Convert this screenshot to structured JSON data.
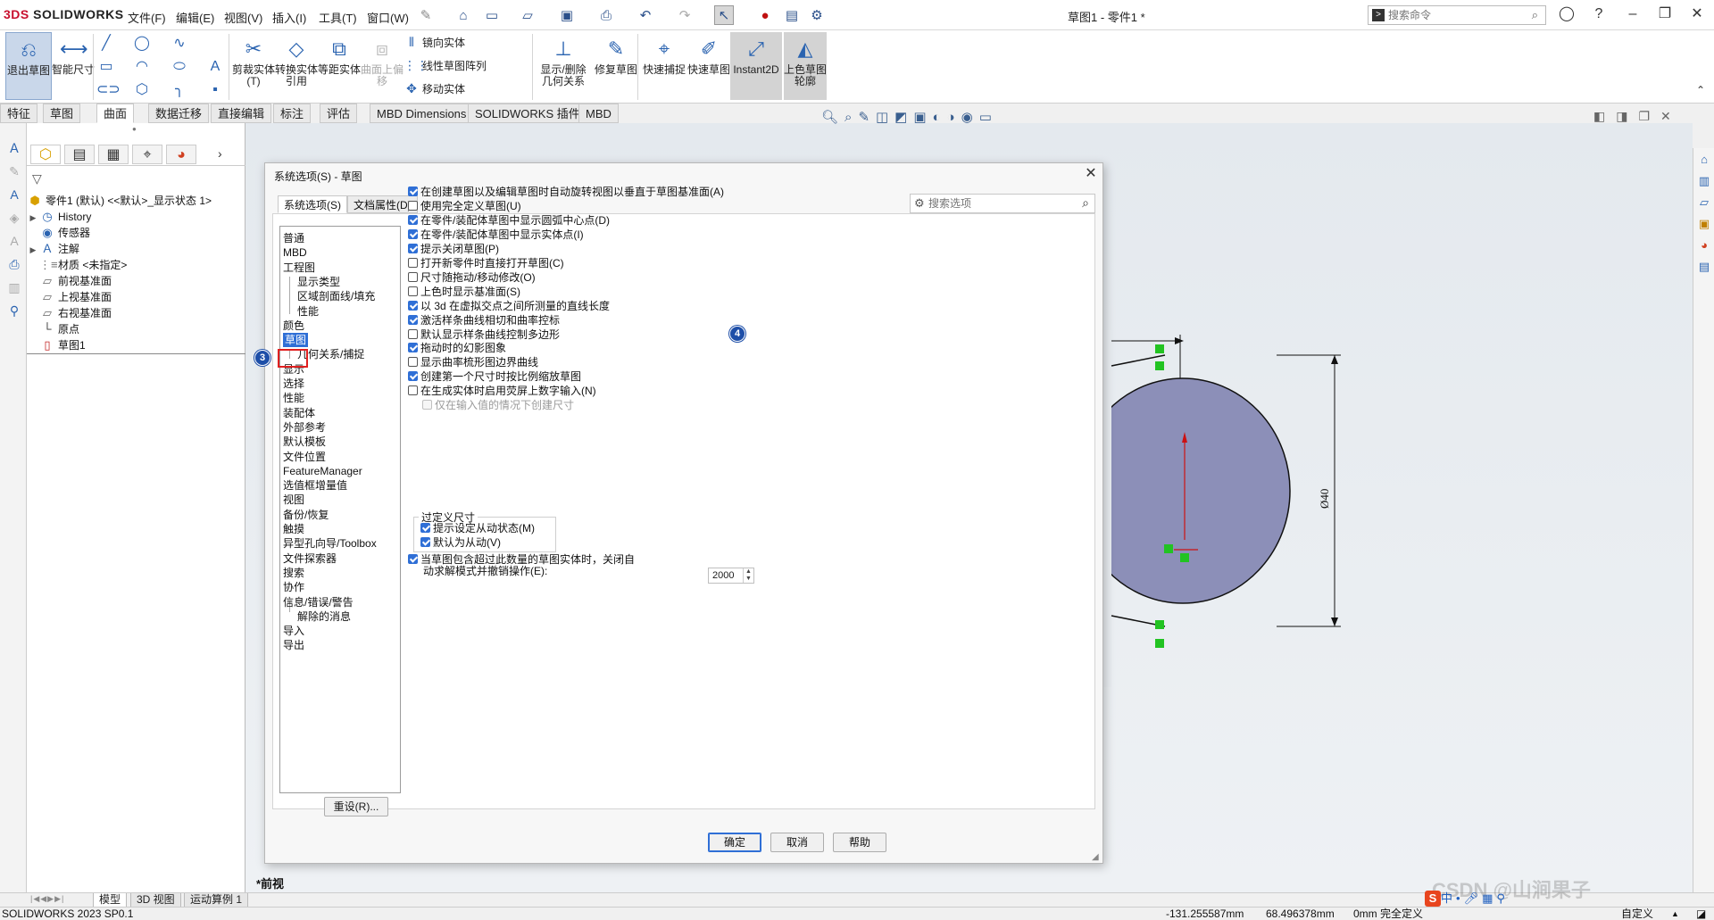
{
  "app": {
    "logo_prefix": "3DS",
    "logo_text": "SOLIDWORKS",
    "title": "草图1 - 零件1 *",
    "menus": [
      "文件(F)",
      "编辑(E)",
      "视图(V)",
      "插入(I)",
      "工具(T)",
      "窗口(W)"
    ],
    "command_search_placeholder": "搜索命令"
  },
  "ribbon": {
    "big_buttons": [
      {
        "label": "退出草图",
        "icon": "exit-sketch-icon"
      },
      {
        "label": "智能尺寸",
        "icon": "smart-dimension-icon"
      },
      {
        "label": "剪裁实体(T)",
        "icon": "trim-icon"
      },
      {
        "label": "转换实体引用",
        "icon": "convert-icon"
      },
      {
        "label": "等距实体",
        "icon": "offset-icon"
      },
      {
        "label": "曲面上偏移",
        "icon": "surface-offset-icon"
      },
      {
        "label": "显示/删除几何关系",
        "icon": "relations-icon"
      },
      {
        "label": "修复草图",
        "icon": "repair-icon"
      },
      {
        "label": "快速捕捉",
        "icon": "quick-snap-icon"
      },
      {
        "label": "快速草图",
        "icon": "rapid-sketch-icon"
      },
      {
        "label": "Instant2D",
        "icon": "instant2d-icon"
      },
      {
        "label": "上色草图轮廓",
        "icon": "shaded-contours-icon"
      }
    ],
    "small_buttons": [
      {
        "label": "镜向实体",
        "icon": "mirror-icon"
      },
      {
        "label": "线性草图阵列",
        "icon": "linear-pattern-icon"
      },
      {
        "label": "移动实体",
        "icon": "move-icon"
      }
    ]
  },
  "command_tabs": [
    "特征",
    "草图",
    "曲面",
    "数据迁移",
    "直接编辑",
    "标注",
    "评估",
    "MBD Dimensions",
    "SOLIDWORKS 插件",
    "MBD"
  ],
  "command_tabs_active": "草图",
  "feature_tree": {
    "root": "零件1 (默认) <<默认>_显示状态 1>",
    "items": [
      {
        "label": "History",
        "expandable": true,
        "icon": "history-icon"
      },
      {
        "label": "传感器",
        "expandable": false,
        "icon": "sensor-icon"
      },
      {
        "label": "注解",
        "expandable": true,
        "icon": "annotation-icon"
      },
      {
        "label": "材质 <未指定>",
        "expandable": false,
        "icon": "material-icon"
      },
      {
        "label": "前视基准面",
        "expandable": false,
        "icon": "plane-icon"
      },
      {
        "label": "上视基准面",
        "expandable": false,
        "icon": "plane-icon"
      },
      {
        "label": "右视基准面",
        "expandable": false,
        "icon": "plane-icon"
      },
      {
        "label": "原点",
        "expandable": false,
        "icon": "origin-icon"
      },
      {
        "label": "草图1",
        "expandable": false,
        "icon": "sketch-icon"
      }
    ]
  },
  "dialog": {
    "title": "系统选项(S) - 草图",
    "tabs": [
      "系统选项(S)",
      "文档属性(D)"
    ],
    "search_placeholder": "搜索选项",
    "nav": [
      {
        "label": "普通",
        "level": 0
      },
      {
        "label": "MBD",
        "level": 0
      },
      {
        "label": "工程图",
        "level": 0
      },
      {
        "label": "显示类型",
        "level": 1
      },
      {
        "label": "区域剖面线/填充",
        "level": 1
      },
      {
        "label": "性能",
        "level": 1
      },
      {
        "label": "颜色",
        "level": 0
      },
      {
        "label": "草图",
        "level": 0,
        "selected": true
      },
      {
        "label": "几何关系/捕捉",
        "level": 1
      },
      {
        "label": "显示",
        "level": 0
      },
      {
        "label": "选择",
        "level": 0
      },
      {
        "label": "性能",
        "level": 0
      },
      {
        "label": "装配体",
        "level": 0
      },
      {
        "label": "外部参考",
        "level": 0
      },
      {
        "label": "默认模板",
        "level": 0
      },
      {
        "label": "文件位置",
        "level": 0
      },
      {
        "label": "FeatureManager",
        "level": 0
      },
      {
        "label": "选值框增量值",
        "level": 0
      },
      {
        "label": "视图",
        "level": 0
      },
      {
        "label": "备份/恢复",
        "level": 0
      },
      {
        "label": "触摸",
        "level": 0
      },
      {
        "label": "异型孔向导/Toolbox",
        "level": 0
      },
      {
        "label": "文件探索器",
        "level": 0
      },
      {
        "label": "搜索",
        "level": 0
      },
      {
        "label": "协作",
        "level": 0
      },
      {
        "label": "信息/错误/警告",
        "level": 0
      },
      {
        "label": "解除的消息",
        "level": 1
      },
      {
        "label": "导入",
        "level": 0
      },
      {
        "label": "导出",
        "level": 0
      }
    ],
    "options": [
      {
        "label": "在创建草图以及编辑草图时自动旋转视图以垂直于草图基准面(A)",
        "checked": true
      },
      {
        "label": "使用完全定义草图(U)",
        "checked": false
      },
      {
        "label": "在零件/装配体草图中显示圆弧中心点(D)",
        "checked": true
      },
      {
        "label": "在零件/装配体草图中显示实体点(I)",
        "checked": true
      },
      {
        "label": "提示关闭草图(P)",
        "checked": true
      },
      {
        "label": "打开新零件时直接打开草图(C)",
        "checked": false
      },
      {
        "label": "尺寸随拖动/移动修改(O)",
        "checked": false
      },
      {
        "label": "上色时显示基准面(S)",
        "checked": false
      },
      {
        "label": "以 3d 在虚拟交点之间所测量的直线长度",
        "checked": true
      },
      {
        "label": "激活样条曲线相切和曲率控标",
        "checked": true
      },
      {
        "label": "默认显示样条曲线控制多边形",
        "checked": false
      },
      {
        "label": "拖动时的幻影图象",
        "checked": true
      },
      {
        "label": "显示曲率梳形图边界曲线",
        "checked": false
      },
      {
        "label": "创建第一个尺寸时按比例缩放草图",
        "checked": true
      },
      {
        "label": "在生成实体时启用荧屏上数字输入(N)",
        "checked": false
      },
      {
        "label": "仅在输入值的情况下创建尺寸",
        "checked": false,
        "disabled": true
      }
    ],
    "overdefined_group": {
      "title": "过定义尺寸",
      "options": [
        {
          "label": "提示设定从动状态(M)",
          "checked": true
        },
        {
          "label": "默认为从动(V)",
          "checked": true
        }
      ]
    },
    "limit_option": {
      "label_line1": "当草图包含超过此数量的草图实体时，关闭自",
      "label_line2": "动求解模式并撤销操作(E):",
      "checked": true,
      "value": "2000"
    },
    "reset_label": "重设(R)...",
    "ok_label": "确定",
    "cancel_label": "取消",
    "help_label": "帮助"
  },
  "annotations": {
    "badge_nav": "3",
    "badge_options": "4"
  },
  "graphics": {
    "view_label": "*前视",
    "dimension_text": "Ø40",
    "circle_fill": "#8c8fb8"
  },
  "bottom_tabs": [
    "模型",
    "3D 视图",
    "运动算例 1"
  ],
  "status": {
    "version": "SOLIDWORKS 2023 SP0.1",
    "x": "-131.255587mm",
    "y": "68.496378mm",
    "z": "0mm",
    "state": "完全定义",
    "mode": "自定义"
  },
  "watermark": "CSDN @山涧果子",
  "ime": {
    "logo": "S",
    "text": "中"
  }
}
